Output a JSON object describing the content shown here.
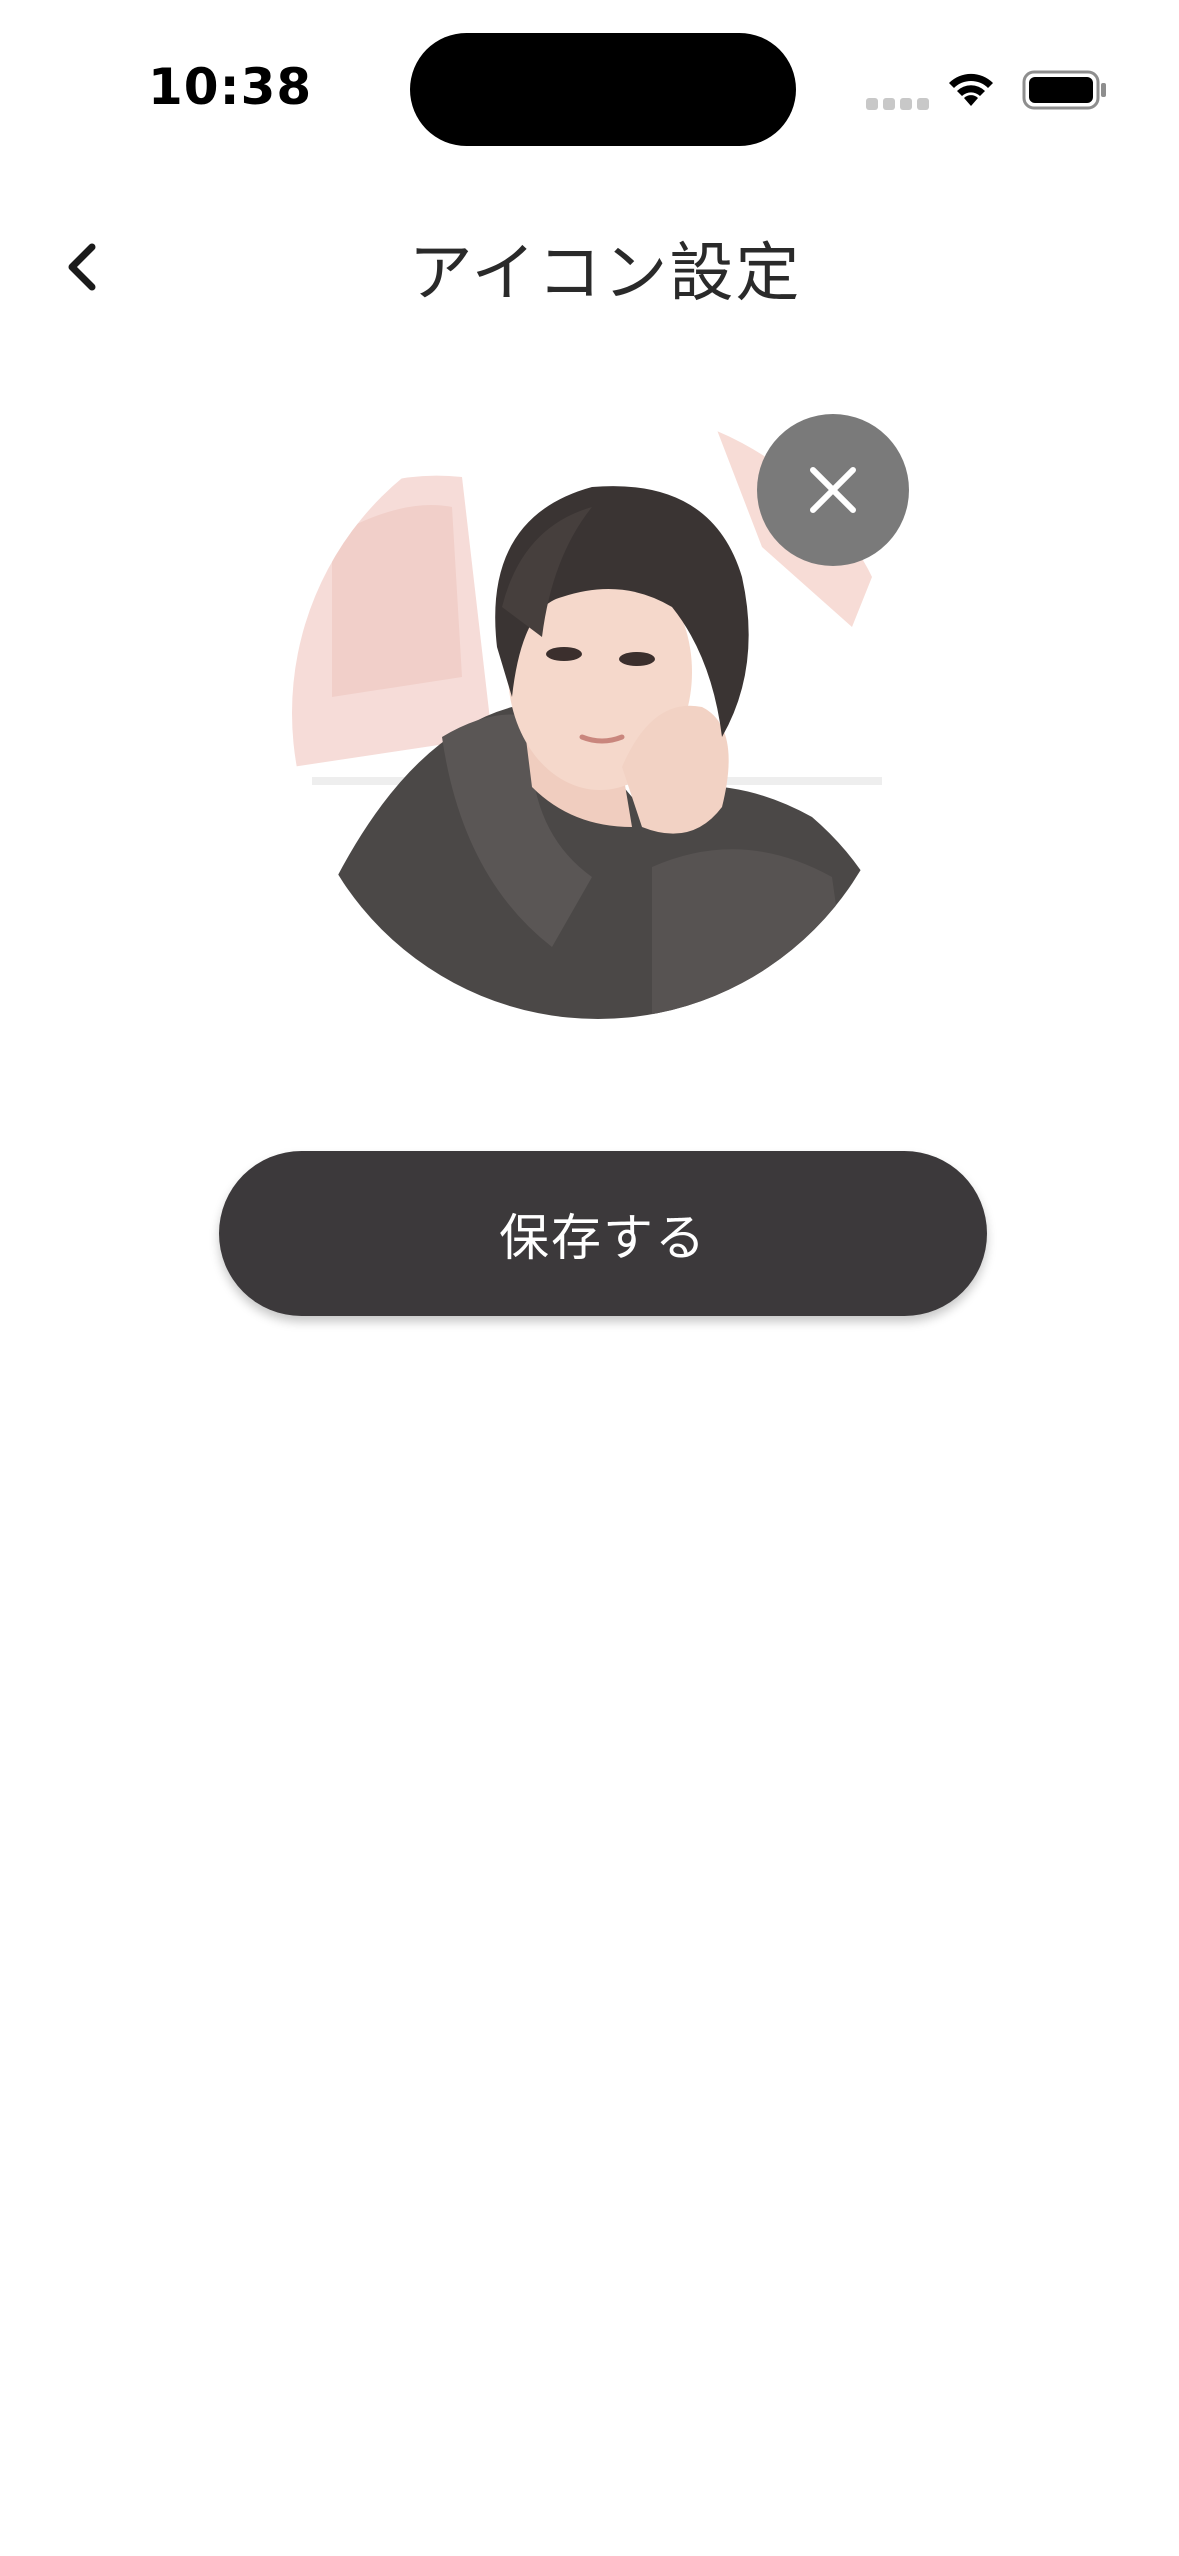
{
  "status_bar": {
    "time": "10:38",
    "icons": [
      "signal-icon",
      "wifi-icon",
      "battery-icon"
    ]
  },
  "nav": {
    "back_icon": "chevron-left-icon",
    "title": "アイコン設定"
  },
  "avatar": {
    "remove_icon": "close-icon",
    "remove_button_color": "#7a7a7a"
  },
  "actions": {
    "save_label": "保存する",
    "save_button_color": "#3c393b"
  }
}
